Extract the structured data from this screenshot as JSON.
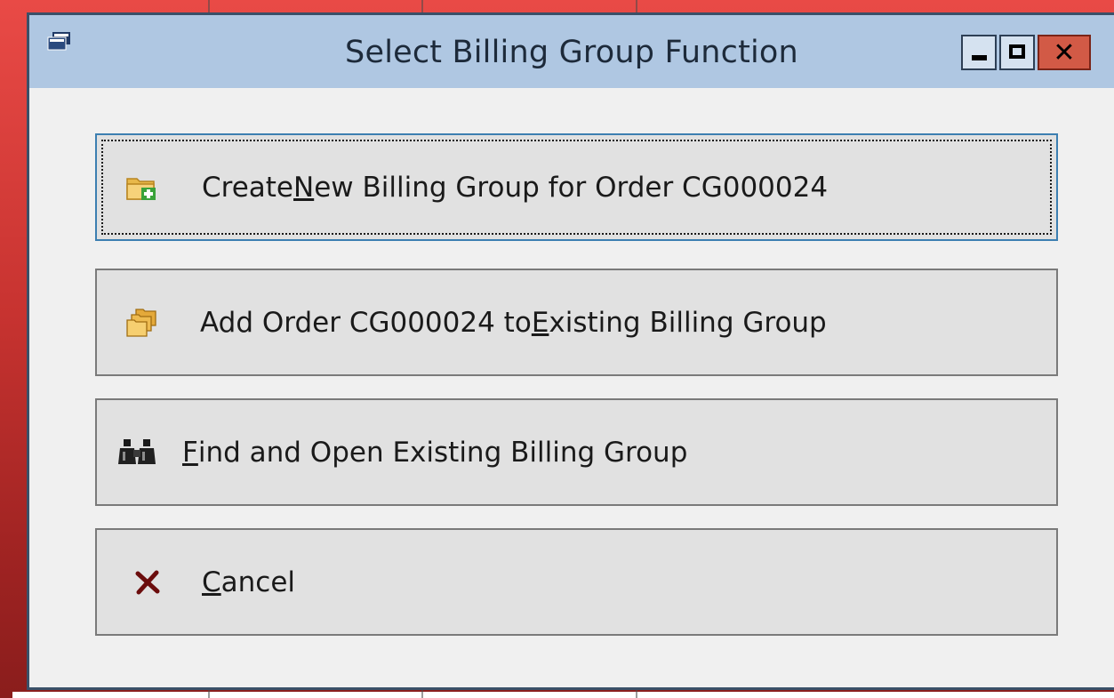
{
  "window": {
    "title": "Select Billing Group Function",
    "controls": {
      "minimize_icon": "minimize-icon",
      "maximize_icon": "maximize-icon",
      "close_icon": "close-icon"
    }
  },
  "buttons": [
    {
      "id": "create",
      "icon": "folder-add-icon",
      "pre": "Create ",
      "mnemonic": "N",
      "post": "ew Billing Group for Order CG000024",
      "focused": true
    },
    {
      "id": "add",
      "icon": "folders-icon",
      "pre": "Add Order CG000024 to ",
      "mnemonic": "E",
      "post": "xisting Billing Group",
      "focused": false
    },
    {
      "id": "find",
      "icon": "binoculars-icon",
      "pre": "",
      "mnemonic": "F",
      "post": "ind and Open Existing Billing Group",
      "focused": false
    },
    {
      "id": "cancel",
      "icon": "cancel-icon",
      "pre": "",
      "mnemonic": "C",
      "post": "ancel",
      "focused": false
    }
  ],
  "colors": {
    "titlebar": "#afc7e2",
    "close_button": "#d25a46",
    "focus_border": "#3c7fb1",
    "cancel_icon": "#6b0c0c"
  }
}
